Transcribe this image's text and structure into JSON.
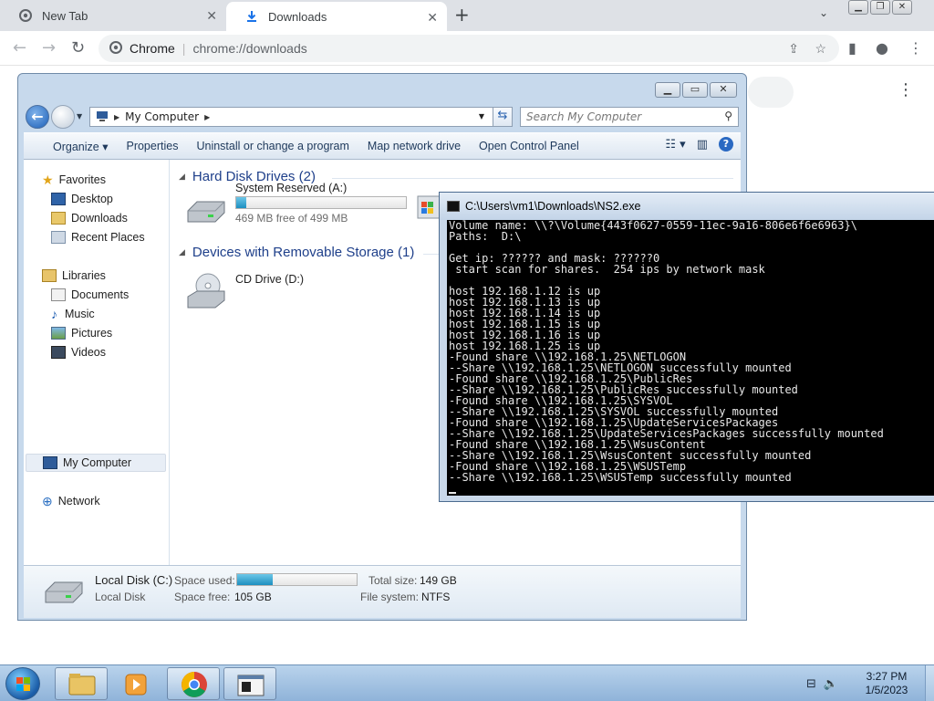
{
  "browser": {
    "tabs": [
      {
        "title": "New Tab"
      },
      {
        "title": "Downloads"
      }
    ],
    "omnibox": {
      "site": "Chrome",
      "url": "chrome://downloads"
    }
  },
  "explorer": {
    "breadcrumb": "My Computer",
    "search_placeholder": "Search My Computer",
    "commands": [
      "Organize",
      "Properties",
      "Uninstall or change a program",
      "Map network drive",
      "Open Control Panel"
    ],
    "nav": {
      "favorites": "Favorites",
      "desktop": "Desktop",
      "downloads": "Downloads",
      "recent": "Recent Places",
      "libraries": "Libraries",
      "documents": "Documents",
      "music": "Music",
      "pictures": "Pictures",
      "videos": "Videos",
      "mycomputer": "My Computer",
      "network": "Network"
    },
    "groups": {
      "hdd": "Hard Disk Drives (2)",
      "removable": "Devices with Removable Storage (1)"
    },
    "drives": {
      "system_reserved": {
        "name": "System Reserved (A:)",
        "free": "469 MB free of 499 MB",
        "used_fraction": 0.06
      },
      "cd": {
        "name": "CD Drive (D:)"
      }
    },
    "details": {
      "name": "Local Disk (C:)",
      "type": "Local Disk",
      "space_used_label": "Space used:",
      "used_fraction": 0.3,
      "space_free_label": "Space free:",
      "space_free": "105 GB",
      "total_size_label": "Total size:",
      "total_size": "149 GB",
      "fs_label": "File system:",
      "fs": "NTFS"
    }
  },
  "console": {
    "title": "C:\\Users\\vm1\\Downloads\\NS2.exe",
    "lines": [
      "Volume name: \\\\?\\Volume{443f0627-0559-11ec-9a16-806e6f6e6963}\\",
      "Paths:  D:\\",
      "",
      "Get ip: ?????? and mask: ??????0",
      " start scan for shares.  254 ips by network mask",
      "",
      "host 192.168.1.12 is up",
      "host 192.168.1.13 is up",
      "host 192.168.1.14 is up",
      "host 192.168.1.15 is up",
      "host 192.168.1.16 is up",
      "host 192.168.1.25 is up",
      "-Found share \\\\192.168.1.25\\NETLOGON",
      "--Share \\\\192.168.1.25\\NETLOGON successfully mounted",
      "-Found share \\\\192.168.1.25\\PublicRes",
      "--Share \\\\192.168.1.25\\PublicRes successfully mounted",
      "-Found share \\\\192.168.1.25\\SYSVOL",
      "--Share \\\\192.168.1.25\\SYSVOL successfully mounted",
      "-Found share \\\\192.168.1.25\\UpdateServicesPackages",
      "--Share \\\\192.168.1.25\\UpdateServicesPackages successfully mounted",
      "-Found share \\\\192.168.1.25\\WsusContent",
      "--Share \\\\192.168.1.25\\WsusContent successfully mounted",
      "-Found share \\\\192.168.1.25\\WSUSTemp",
      "--Share \\\\192.168.1.25\\WSUSTemp successfully mounted"
    ]
  },
  "taskbar": {
    "time": "3:27 PM",
    "date": "1/5/2023"
  }
}
